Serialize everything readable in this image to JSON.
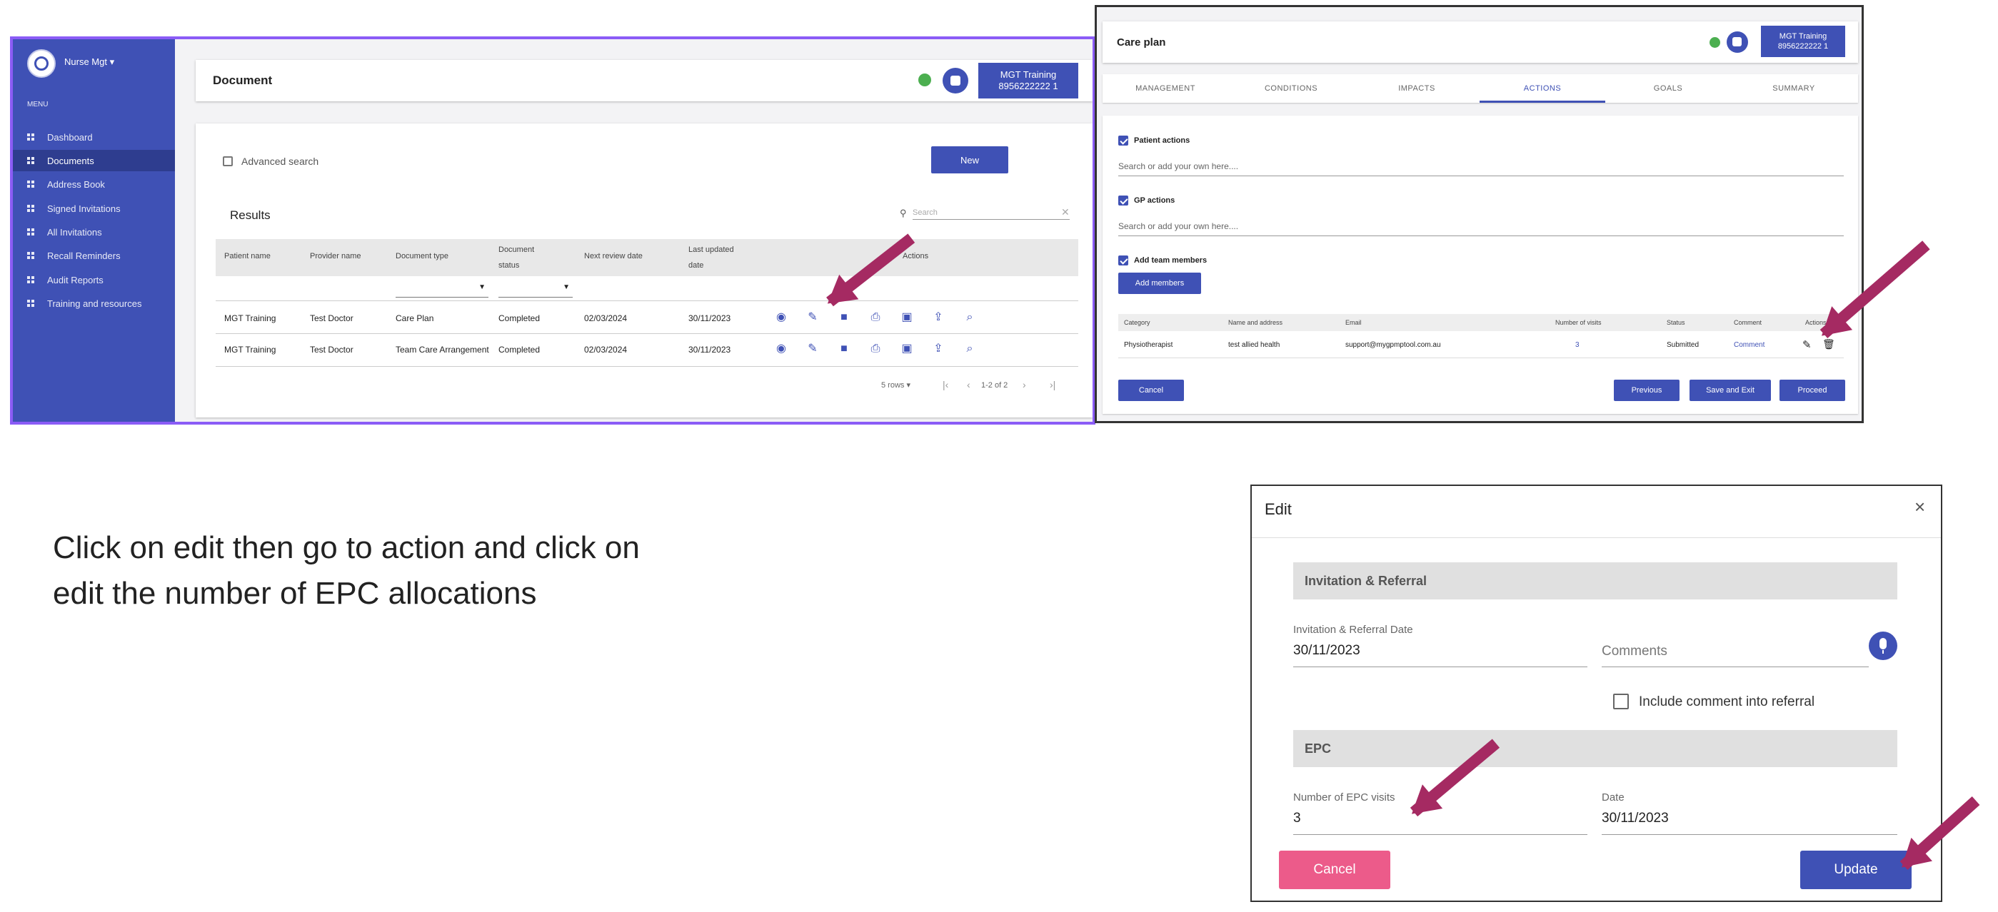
{
  "panel1": {
    "user": "Nurse Mgt",
    "menu_caption": "MENU",
    "nav": [
      "Dashboard",
      "Documents",
      "Address Book",
      "Signed Invitations",
      "All Invitations",
      "Recall Reminders",
      "Audit Reports",
      "Training and resources"
    ],
    "page_title": "Document",
    "patient_line1": "MGT Training",
    "patient_line2": "8956222222 1",
    "advanced_search": "Advanced search",
    "new_button": "New",
    "results_title": "Results",
    "search_placeholder": "Search",
    "columns": [
      "Patient name",
      "Provider name",
      "Document type",
      "Document status",
      "Next review date",
      "Last updated date",
      "Actions"
    ],
    "rows": [
      [
        "MGT Training",
        "Test Doctor",
        "Care Plan",
        "Completed",
        "02/03/2024",
        "30/11/2023"
      ],
      [
        "MGT Training",
        "Test Doctor",
        "Team Care Arrangement",
        "Completed",
        "02/03/2024",
        "30/11/2023"
      ]
    ],
    "rows_per_page": "5 rows",
    "pagination": "1-2 of 2"
  },
  "panel2": {
    "title": "Care plan",
    "patient_line1": "MGT Training",
    "patient_line2": "8956222222 1",
    "tabs": [
      "MANAGEMENT",
      "CONDITIONS",
      "IMPACTS",
      "ACTIONS",
      "GOALS",
      "SUMMARY"
    ],
    "patient_actions": "Patient actions",
    "gp_actions": "GP actions",
    "add_team_members": "Add team members",
    "search_placeholder": "Search or add your own here....",
    "add_members_button": "Add members",
    "columns": [
      "Category",
      "Name and address",
      "Email",
      "Number of visits",
      "Status",
      "Comment",
      "Actions"
    ],
    "row": [
      "Physiotherapist",
      "test allied health",
      "support@mygpmptool.com.au",
      "3",
      "Submitted",
      "Comment"
    ],
    "cancel": "Cancel",
    "previous": "Previous",
    "save_exit": "Save and Exit",
    "proceed": "Proceed"
  },
  "panel3": {
    "title": "Edit",
    "close": "×",
    "section1": "Invitation & Referral",
    "ir_date_label": "Invitation & Referral Date",
    "ir_date_value": "30/11/2023",
    "comments_placeholder": "Comments",
    "include_comment": "Include comment into referral",
    "section2": "EPC",
    "epc_label": "Number of EPC visits",
    "epc_value": "3",
    "date_label": "Date",
    "date_value": "30/11/2023",
    "cancel": "Cancel",
    "update": "Update"
  },
  "instruction": "Click on edit then go to action and click on edit the number of EPC allocations",
  "colors": {
    "primary": "#3f51b5",
    "arrow": "#a52a62",
    "highlight": "#8b5cf6",
    "cancel_pink": "#ec5b8a",
    "green": "#4caf50"
  }
}
